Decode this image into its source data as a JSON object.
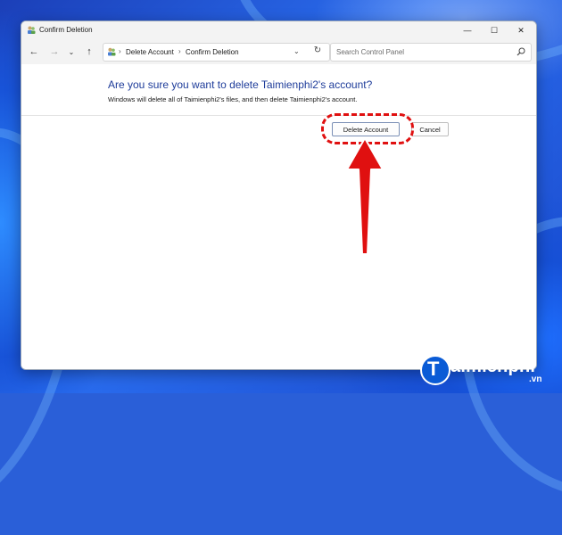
{
  "window": {
    "title": "Confirm Deletion",
    "controls": {
      "minimize": "—",
      "maximize": "☐",
      "close": "✕"
    }
  },
  "toolbar": {
    "back": "←",
    "forward": "→",
    "dropdown": "⌄",
    "up": "↑",
    "breadcrumb": [
      "Delete Account",
      "Confirm Deletion"
    ],
    "separator": "›",
    "address_dropdown": "⌄",
    "refresh": "↻",
    "search_placeholder": "Search Control Panel"
  },
  "dialog": {
    "question": "Are you sure you want to delete Taimienphi2's account?",
    "description": "Windows will delete all of Taimienphi2's files, and then delete Taimienphi2's account.",
    "delete_label": "Delete Account",
    "cancel_label": "Cancel"
  },
  "annotation": {
    "color": "#e01010"
  },
  "watermark": {
    "brand": "aimienphi",
    "logo_letter": "T",
    "tld": ".vn"
  }
}
